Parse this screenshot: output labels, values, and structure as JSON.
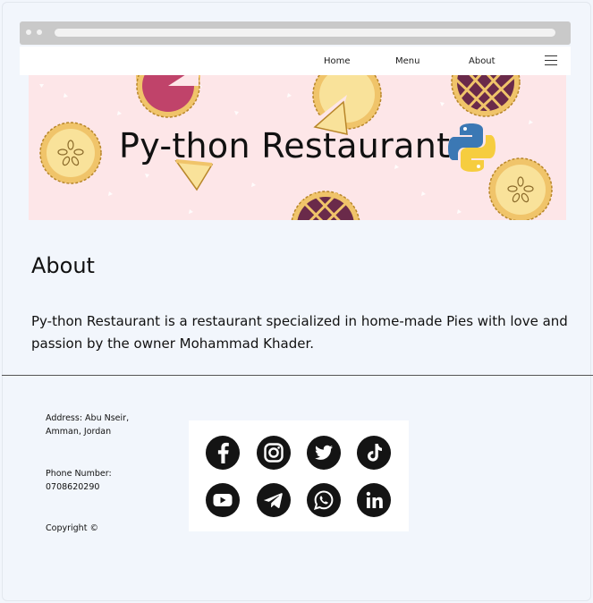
{
  "nav": {
    "links": [
      {
        "label": "Home"
      },
      {
        "label": "Menu"
      },
      {
        "label": "About"
      }
    ]
  },
  "banner": {
    "title": "Py-thon Restaurant"
  },
  "about": {
    "heading": "About",
    "paragraph": "Py-thon Restaurant is a restaurant specialized in home-made Pies with love and passion by the owner Mohammad Khader."
  },
  "footer": {
    "address_line1": "Address: Abu Nseir,",
    "address_line2": "Amman, Jordan",
    "phone_label": "Phone Number:",
    "phone_value": "0708620290",
    "copyright": "Copyright ©"
  },
  "social": [
    "facebook-icon",
    "instagram-icon",
    "twitter-icon",
    "tiktok-icon",
    "youtube-icon",
    "telegram-icon",
    "whatsapp-icon",
    "linkedin-icon"
  ],
  "colors": {
    "page_bg": "#f2f6fc",
    "banner_bg": "#fde6e8",
    "icon_bg": "#141414",
    "pie_crust": "#f0c46a",
    "pie_fill": "#f9e29a",
    "berry_fill": "#6a2a4a",
    "cherry_fill": "#c0436a",
    "python_blue": "#3b78b4",
    "python_yellow": "#f6cd3f"
  }
}
